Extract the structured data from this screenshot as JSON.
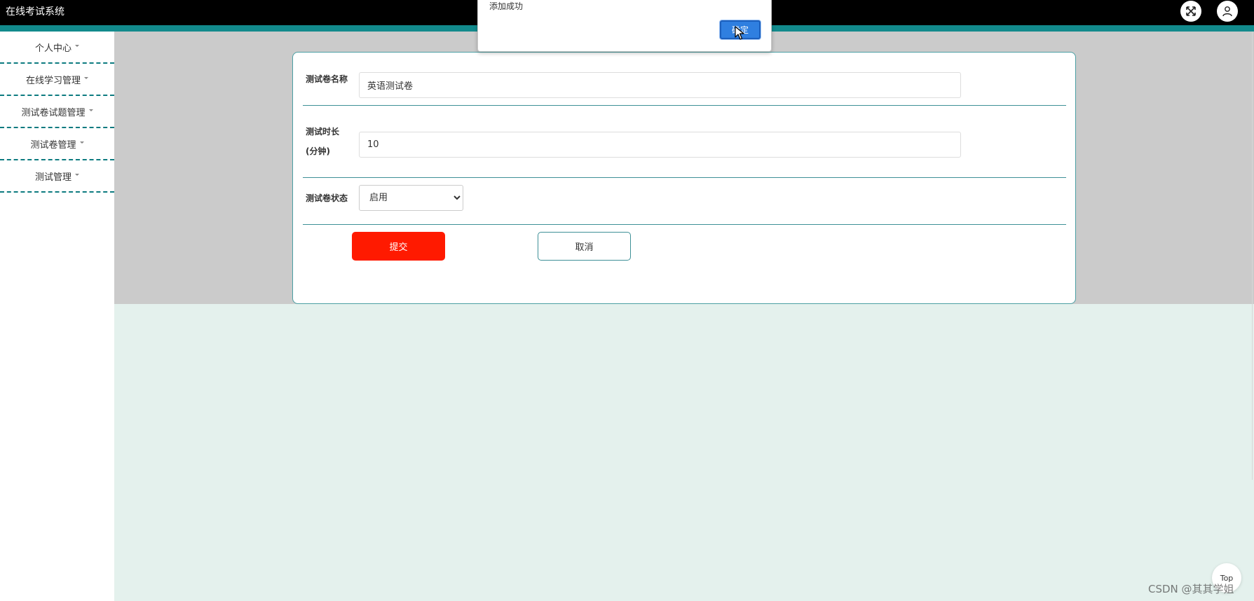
{
  "header": {
    "app_title": "在线考试系统"
  },
  "sidebar": {
    "items": [
      {
        "label": "个人中心"
      },
      {
        "label": "在线学习管理"
      },
      {
        "label": "测试卷试题管理"
      },
      {
        "label": "测试卷管理"
      },
      {
        "label": "测试管理"
      }
    ]
  },
  "form": {
    "name_label": "测试卷名称",
    "name_value": "英语测试卷",
    "duration_label_line1": "测试时长",
    "duration_label_line2": "(分钟)",
    "duration_value": "10",
    "status_label": "测试卷状态",
    "status_selected": "启用",
    "submit_label": "提交",
    "cancel_label": "取消"
  },
  "alert": {
    "message": "添加成功",
    "ok_label": "确定"
  },
  "floating": {
    "top_label": "Top"
  },
  "watermark": "CSDN @其其学姐",
  "icons": {
    "fullscreen": "expand-arrows-icon",
    "user": "user-icon",
    "cursor": "mouse-pointer-icon"
  },
  "colors": {
    "header_bg": "#000000",
    "accent_teal": "#128a8c",
    "submit_red": "#ff1a00",
    "alert_button_blue": "#2f7fe0",
    "main_bg": "#e4f1ed"
  }
}
